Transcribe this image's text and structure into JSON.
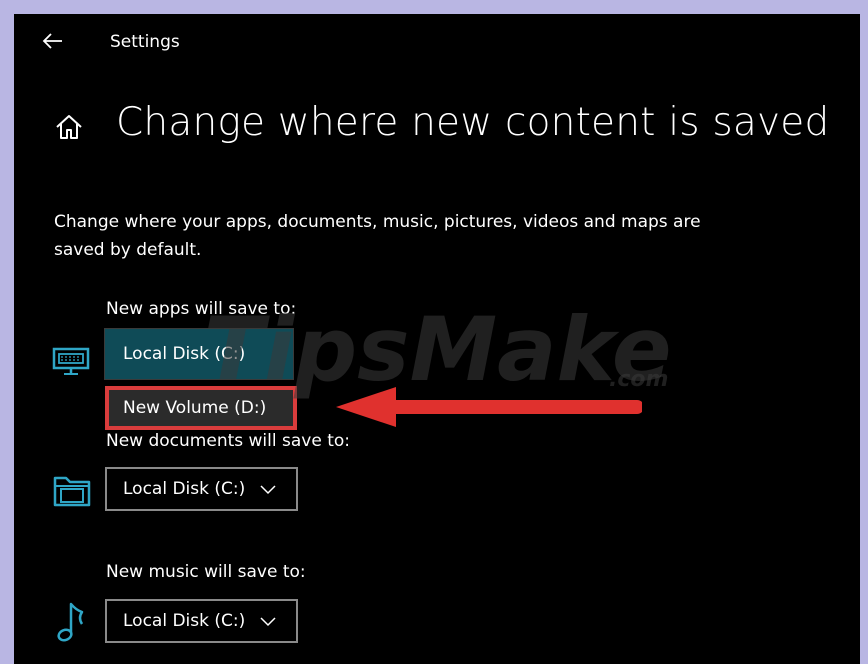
{
  "window": {
    "title": "Settings"
  },
  "header": {
    "back_icon": "back-arrow-icon",
    "home_icon": "home-icon"
  },
  "page": {
    "title": "Change where new content is saved",
    "description": "Change where your apps, documents, music, pictures, videos and maps are saved by default."
  },
  "sections": {
    "apps": {
      "label": "New apps will save to:",
      "icon": "monitor-keyboard-icon",
      "selected": "Local Disk (C:)",
      "open_option": "New Volume (D:)"
    },
    "documents": {
      "label": "New documents will save to:",
      "icon": "folder-icon",
      "selected": "Local Disk (C:)"
    },
    "music": {
      "label": "New music will save to:",
      "icon": "music-note-icon",
      "selected": "Local Disk (C:)"
    }
  },
  "watermark": {
    "text": "TipsMake",
    "suffix": ".com"
  },
  "colors": {
    "accent": "#2fa6c6",
    "highlight": "#d93c3c",
    "dropdown_open_bg": "#0f4b57",
    "frame": "#b9b6e3"
  }
}
